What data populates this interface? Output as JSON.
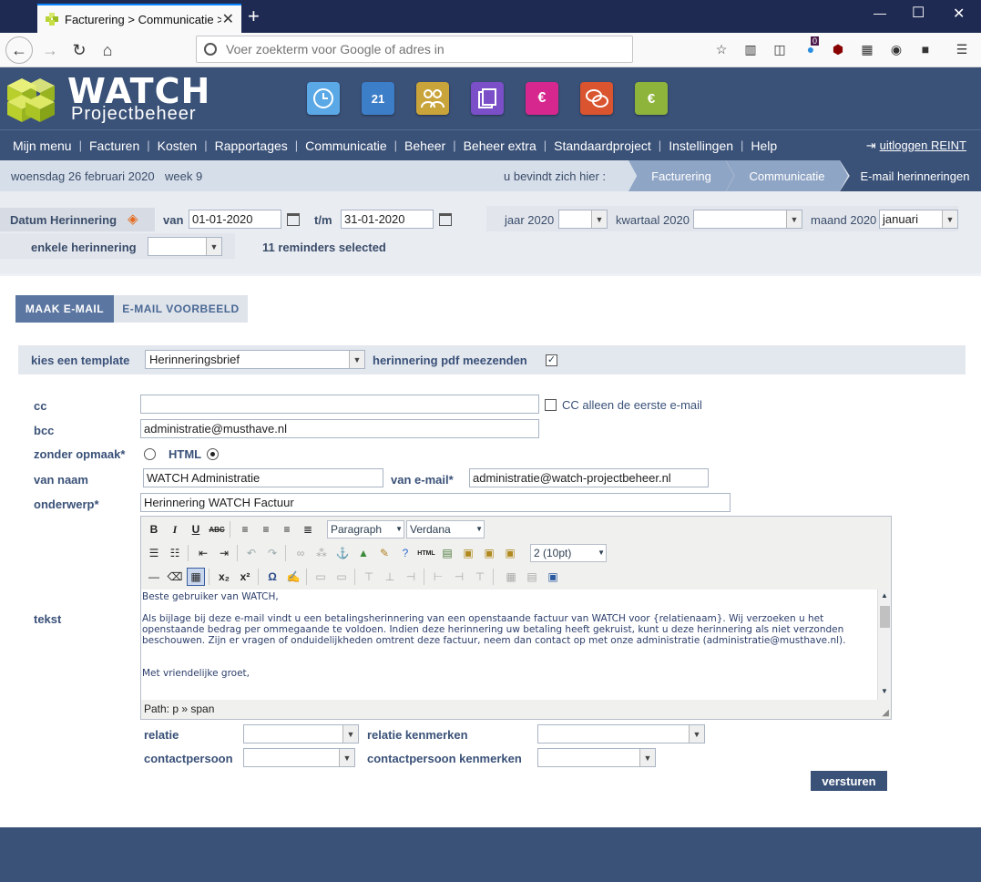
{
  "browser": {
    "tab_title": "Facturering > Communicatie >",
    "url_placeholder": "Voer zoekterm voor Google of adres in",
    "badge_count": "0"
  },
  "header": {
    "logo_title": "WATCH",
    "logo_subtitle": "Projectbeheer",
    "app_icons": [
      {
        "name": "clock-icon",
        "color": "#5aa9e6"
      },
      {
        "name": "calendar-icon",
        "color": "#3d7ec9",
        "label": "21"
      },
      {
        "name": "people-icon",
        "color": "#c9a43a"
      },
      {
        "name": "documents-icon",
        "color": "#7a4fc7"
      },
      {
        "name": "invoice-icon",
        "color": "#d6278f",
        "label": "€"
      },
      {
        "name": "chat-icon",
        "color": "#d9542f"
      },
      {
        "name": "calculator-icon",
        "color": "#8fb43c",
        "label": "€"
      }
    ]
  },
  "menu": {
    "items": [
      "Mijn menu",
      "Facturen",
      "Kosten",
      "Rapportages",
      "Communicatie",
      "Beheer",
      "Beheer extra",
      "Standaardproject",
      "Instellingen",
      "Help"
    ],
    "logout": "uitloggen REINT"
  },
  "breadcrumb": {
    "date": "woensdag 26 februari 2020",
    "week": "week 9",
    "here": "u bevindt zich hier :",
    "steps": [
      "Facturering",
      "Communicatie",
      "E-mail herinneringen"
    ]
  },
  "filters": {
    "date_label": "Datum Herinnering",
    "from_label": "van",
    "from_value": "01-01-2020",
    "to_label": "t/m",
    "to_value": "31-01-2020",
    "year_label": "jaar 2020",
    "year_value": "",
    "quarter_label": "kwartaal 2020",
    "quarter_value": "",
    "month_label": "maand 2020",
    "month_value": "januari",
    "single_label": "enkele herinnering",
    "single_value": "",
    "selected_text": "11 reminders selected"
  },
  "tabs": {
    "make": "MAAK E-MAIL",
    "preview": "E-MAIL VOORBEELD"
  },
  "form": {
    "template_label": "kies een template",
    "template_value": "Herinneringsbrief",
    "pdf_label": "herinnering pdf meezenden",
    "pdf_checked": "✓",
    "cc_label": "cc",
    "cc_value": "",
    "cc_first_label": "CC alleen de eerste e-mail",
    "bcc_label": "bcc",
    "bcc_value": "administratie@musthave.nl",
    "format_label": "zonder opmaak*",
    "html_label": "HTML",
    "from_name_label": "van naam",
    "from_name_value": "WATCH Administratie",
    "from_email_label": "van e-mail*",
    "from_email_value": "administratie@watch-projectbeheer.nl",
    "subject_label": "onderwerp*",
    "subject_value": "Herinnering WATCH Factuur",
    "text_label": "tekst",
    "editor": {
      "format_value": "Paragraph",
      "font_value": "Verdana",
      "size_value": "2 (10pt)",
      "lines": [
        "Beste gebruiker van WATCH,",
        "",
        "Als bijlage bij deze e-mail vindt u een betalingsherinnering van een openstaande factuur van WATCH voor {relatienaam}. Wij verzoeken u het openstaande bedrag per ommegaande te voldoen. Indien deze herinnering uw betaling heeft gekruist, kunt u deze herinnering als niet verzonden beschouwen. Zijn er vragen of onduidelijkheden omtrent deze factuur, neem dan contact op met onze administratie (administratie@musthave.nl).",
        "",
        "",
        "Met vriendelijke groet,"
      ],
      "path": "Path: p » span"
    },
    "relatie_label": "relatie",
    "relatie_kenmerken_label": "relatie kenmerken",
    "contactpersoon_label": "contactpersoon",
    "contactpersoon_kenmerken_label": "contactpersoon kenmerken",
    "send_label": "versturen"
  }
}
